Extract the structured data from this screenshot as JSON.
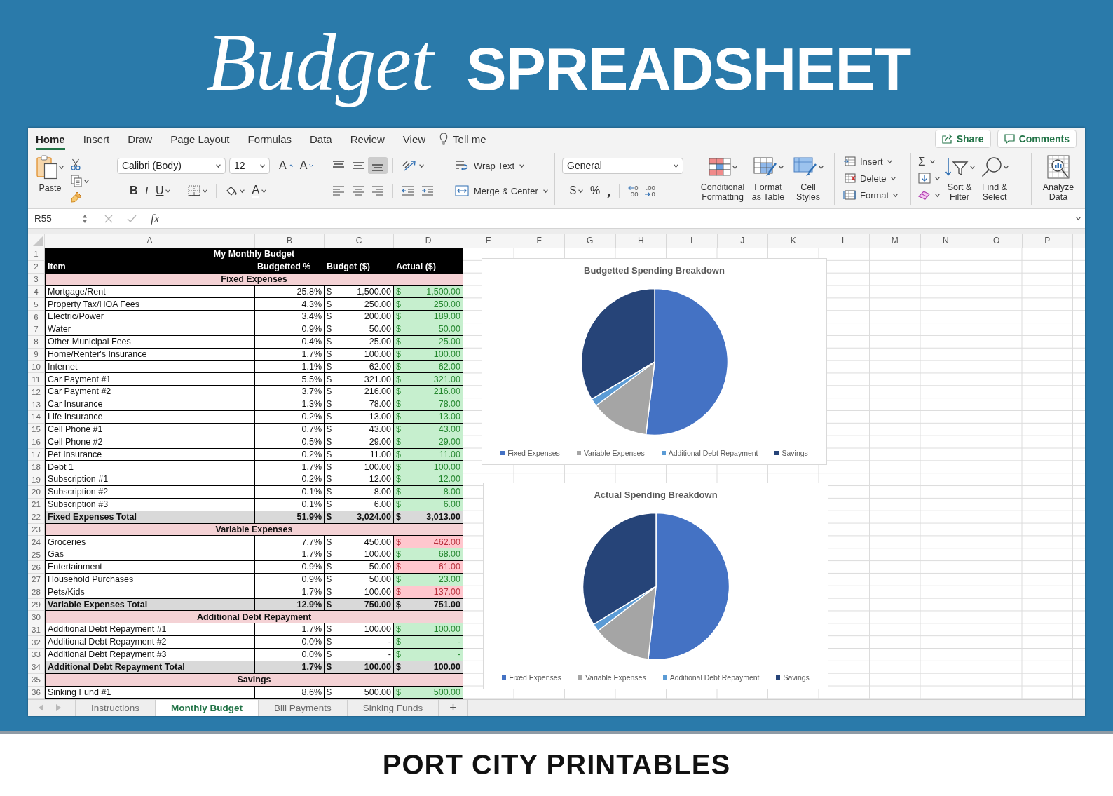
{
  "banner": {
    "script_title": "Budget",
    "title": "SPREADSHEET"
  },
  "menu_tabs": [
    {
      "label": "Home",
      "selected": true
    },
    {
      "label": "Insert",
      "selected": false
    },
    {
      "label": "Draw",
      "selected": false
    },
    {
      "label": "Page Layout",
      "selected": false
    },
    {
      "label": "Formulas",
      "selected": false
    },
    {
      "label": "Data",
      "selected": false
    },
    {
      "label": "Review",
      "selected": false
    },
    {
      "label": "View",
      "selected": false
    }
  ],
  "tell_me": "Tell me",
  "share_button": "Share",
  "comments_button": "Comments",
  "ribbon": {
    "paste": "Paste",
    "font_name": "Calibri (Body)",
    "font_size": "12",
    "grow_font": "A",
    "shrink_font": "A",
    "bold": "B",
    "italic": "I",
    "underline": "U",
    "font_color": "A",
    "vertical_align": [
      {
        "kind": "top",
        "selected": false
      },
      {
        "kind": "middle",
        "selected": false
      },
      {
        "kind": "bottom",
        "selected": true
      }
    ],
    "wrap_text": "Wrap Text",
    "merge_center": "Merge & Center",
    "number_format": "General",
    "currency": "$",
    "percent": "%",
    "comma": ",",
    "decimal_buttons": [
      {
        "kind": "increase",
        "lines": [
          "0",
          ".00"
        ]
      },
      {
        "kind": "decrease",
        "lines": [
          ".00",
          "0"
        ]
      }
    ],
    "style_buttons": [
      {
        "kind": "conditional",
        "label": "Conditional Formatting"
      },
      {
        "kind": "table",
        "label": "Format as Table"
      },
      {
        "kind": "cell_styles",
        "label": "Cell Styles"
      }
    ],
    "cell_buttons": [
      {
        "kind": "insert",
        "label": "Insert"
      },
      {
        "kind": "delete",
        "label": "Delete"
      },
      {
        "kind": "format",
        "label": "Format"
      }
    ],
    "autosum": "Σ",
    "sort_filter": "Sort & Filter",
    "find_select": "Find & Select",
    "analyze_data": "Analyze Data"
  },
  "formula_bar": {
    "cell_reference": "R55",
    "function_label": "fx"
  },
  "columns": [
    "A",
    "B",
    "C",
    "D",
    "E",
    "F",
    "G",
    "H",
    "I",
    "J",
    "K",
    "L",
    "M",
    "N",
    "O",
    "P"
  ],
  "rows": [
    {
      "number": "1",
      "kind": "title",
      "text": "My Monthly Budget"
    },
    {
      "number": "2",
      "kind": "header",
      "cells": [
        "Item",
        "Budgetted %",
        "Budget ($)",
        "Actual ($)"
      ]
    },
    {
      "number": "3",
      "kind": "section",
      "text": "Fixed Expenses"
    },
    {
      "number": "4",
      "kind": "item",
      "item": "Mortgage/Rent",
      "percent": "25.8%",
      "budget": {
        "symbol": "$",
        "amount": "1,500.00"
      },
      "actual": {
        "symbol": "$",
        "amount": "1,500.00"
      },
      "over_budget": false
    },
    {
      "number": "5",
      "kind": "item",
      "item": "Property Tax/HOA Fees",
      "percent": "4.3%",
      "budget": {
        "symbol": "$",
        "amount": "250.00"
      },
      "actual": {
        "symbol": "$",
        "amount": "250.00"
      },
      "over_budget": false
    },
    {
      "number": "6",
      "kind": "item",
      "item": "Electric/Power",
      "percent": "3.4%",
      "budget": {
        "symbol": "$",
        "amount": "200.00"
      },
      "actual": {
        "symbol": "$",
        "amount": "189.00"
      },
      "over_budget": false
    },
    {
      "number": "7",
      "kind": "item",
      "item": "Water",
      "percent": "0.9%",
      "budget": {
        "symbol": "$",
        "amount": "50.00"
      },
      "actual": {
        "symbol": "$",
        "amount": "50.00"
      },
      "over_budget": false
    },
    {
      "number": "8",
      "kind": "item",
      "item": "Other Municipal Fees",
      "percent": "0.4%",
      "budget": {
        "symbol": "$",
        "amount": "25.00"
      },
      "actual": {
        "symbol": "$",
        "amount": "25.00"
      },
      "over_budget": false
    },
    {
      "number": "9",
      "kind": "item",
      "item": "Home/Renter's Insurance",
      "percent": "1.7%",
      "budget": {
        "symbol": "$",
        "amount": "100.00"
      },
      "actual": {
        "symbol": "$",
        "amount": "100.00"
      },
      "over_budget": false
    },
    {
      "number": "10",
      "kind": "item",
      "item": "Internet",
      "percent": "1.1%",
      "budget": {
        "symbol": "$",
        "amount": "62.00"
      },
      "actual": {
        "symbol": "$",
        "amount": "62.00"
      },
      "over_budget": false
    },
    {
      "number": "11",
      "kind": "item",
      "item": "Car Payment #1",
      "percent": "5.5%",
      "budget": {
        "symbol": "$",
        "amount": "321.00"
      },
      "actual": {
        "symbol": "$",
        "amount": "321.00"
      },
      "over_budget": false
    },
    {
      "number": "12",
      "kind": "item",
      "item": "Car Payment #2",
      "percent": "3.7%",
      "budget": {
        "symbol": "$",
        "amount": "216.00"
      },
      "actual": {
        "symbol": "$",
        "amount": "216.00"
      },
      "over_budget": false
    },
    {
      "number": "13",
      "kind": "item",
      "item": "Car Insurance",
      "percent": "1.3%",
      "budget": {
        "symbol": "$",
        "amount": "78.00"
      },
      "actual": {
        "symbol": "$",
        "amount": "78.00"
      },
      "over_budget": false
    },
    {
      "number": "14",
      "kind": "item",
      "item": "Life Insurance",
      "percent": "0.2%",
      "budget": {
        "symbol": "$",
        "amount": "13.00"
      },
      "actual": {
        "symbol": "$",
        "amount": "13.00"
      },
      "over_budget": false
    },
    {
      "number": "15",
      "kind": "item",
      "item": "Cell Phone #1",
      "percent": "0.7%",
      "budget": {
        "symbol": "$",
        "amount": "43.00"
      },
      "actual": {
        "symbol": "$",
        "amount": "43.00"
      },
      "over_budget": false
    },
    {
      "number": "16",
      "kind": "item",
      "item": "Cell Phone #2",
      "percent": "0.5%",
      "budget": {
        "symbol": "$",
        "amount": "29.00"
      },
      "actual": {
        "symbol": "$",
        "amount": "29.00"
      },
      "over_budget": false
    },
    {
      "number": "17",
      "kind": "item",
      "item": "Pet Insurance",
      "percent": "0.2%",
      "budget": {
        "symbol": "$",
        "amount": "11.00"
      },
      "actual": {
        "symbol": "$",
        "amount": "11.00"
      },
      "over_budget": false
    },
    {
      "number": "18",
      "kind": "item",
      "item": "Debt 1",
      "percent": "1.7%",
      "budget": {
        "symbol": "$",
        "amount": "100.00"
      },
      "actual": {
        "symbol": "$",
        "amount": "100.00"
      },
      "over_budget": false
    },
    {
      "number": "19",
      "kind": "item",
      "item": "Subscription #1",
      "percent": "0.2%",
      "budget": {
        "symbol": "$",
        "amount": "12.00"
      },
      "actual": {
        "symbol": "$",
        "amount": "12.00"
      },
      "over_budget": false
    },
    {
      "number": "20",
      "kind": "item",
      "item": "Subscription #2",
      "percent": "0.1%",
      "budget": {
        "symbol": "$",
        "amount": "8.00"
      },
      "actual": {
        "symbol": "$",
        "amount": "8.00"
      },
      "over_budget": false
    },
    {
      "number": "21",
      "kind": "item",
      "item": "Subscription #3",
      "percent": "0.1%",
      "budget": {
        "symbol": "$",
        "amount": "6.00"
      },
      "actual": {
        "symbol": "$",
        "amount": "6.00"
      },
      "over_budget": false
    },
    {
      "number": "22",
      "kind": "total",
      "item": "Fixed Expenses Total",
      "percent": "51.9%",
      "budget": {
        "symbol": "$",
        "amount": "3,024.00"
      },
      "actual": {
        "symbol": "$",
        "amount": "3,013.00"
      }
    },
    {
      "number": "23",
      "kind": "section",
      "text": "Variable Expenses"
    },
    {
      "number": "24",
      "kind": "item",
      "item": "Groceries",
      "percent": "7.7%",
      "budget": {
        "symbol": "$",
        "amount": "450.00"
      },
      "actual": {
        "symbol": "$",
        "amount": "462.00"
      },
      "over_budget": true
    },
    {
      "number": "25",
      "kind": "item",
      "item": "Gas",
      "percent": "1.7%",
      "budget": {
        "symbol": "$",
        "amount": "100.00"
      },
      "actual": {
        "symbol": "$",
        "amount": "68.00"
      },
      "over_budget": false
    },
    {
      "number": "26",
      "kind": "item",
      "item": "Entertainment",
      "percent": "0.9%",
      "budget": {
        "symbol": "$",
        "amount": "50.00"
      },
      "actual": {
        "symbol": "$",
        "amount": "61.00"
      },
      "over_budget": true
    },
    {
      "number": "27",
      "kind": "item",
      "item": "Household Purchases",
      "percent": "0.9%",
      "budget": {
        "symbol": "$",
        "amount": "50.00"
      },
      "actual": {
        "symbol": "$",
        "amount": "23.00"
      },
      "over_budget": false
    },
    {
      "number": "28",
      "kind": "item",
      "item": "Pets/Kids",
      "percent": "1.7%",
      "budget": {
        "symbol": "$",
        "amount": "100.00"
      },
      "actual": {
        "symbol": "$",
        "amount": "137.00"
      },
      "over_budget": true
    },
    {
      "number": "29",
      "kind": "total",
      "item": "Variable Expenses Total",
      "percent": "12.9%",
      "budget": {
        "symbol": "$",
        "amount": "750.00"
      },
      "actual": {
        "symbol": "$",
        "amount": "751.00"
      }
    },
    {
      "number": "30",
      "kind": "section",
      "text": "Additional Debt Repayment"
    },
    {
      "number": "31",
      "kind": "item",
      "item": "Additional Debt Repayment #1",
      "percent": "1.7%",
      "budget": {
        "symbol": "$",
        "amount": "100.00"
      },
      "actual": {
        "symbol": "$",
        "amount": "100.00"
      },
      "over_budget": false
    },
    {
      "number": "32",
      "kind": "item",
      "item": "Additional Debt Repayment #2",
      "percent": "0.0%",
      "budget": {
        "symbol": "$",
        "amount": "-"
      },
      "actual": {
        "symbol": "$",
        "amount": "-"
      },
      "over_budget": false
    },
    {
      "number": "33",
      "kind": "item",
      "item": "Additional Debt Repayment #3",
      "percent": "0.0%",
      "budget": {
        "symbol": "$",
        "amount": "-"
      },
      "actual": {
        "symbol": "$",
        "amount": "-"
      },
      "over_budget": false
    },
    {
      "number": "34",
      "kind": "total",
      "item": "Additional Debt Repayment Total",
      "percent": "1.7%",
      "budget": {
        "symbol": "$",
        "amount": "100.00"
      },
      "actual": {
        "symbol": "$",
        "amount": "100.00"
      }
    },
    {
      "number": "35",
      "kind": "section",
      "text": "Savings"
    },
    {
      "number": "36",
      "kind": "item",
      "item": "Sinking Fund #1",
      "percent": "8.6%",
      "budget": {
        "symbol": "$",
        "amount": "500.00"
      },
      "actual": {
        "symbol": "$",
        "amount": "500.00"
      },
      "over_budget": false
    }
  ],
  "charts": [
    {
      "chart_data": {
        "type": "pie",
        "title": "Budgetted Spending Breakdown",
        "categories": [
          "Fixed Expenses",
          "Variable Expenses",
          "Additional Debt Repayment",
          "Savings"
        ],
        "values": [
          51.9,
          12.9,
          1.7,
          33.5
        ],
        "colors": [
          "#4472c4",
          "#a5a5a5",
          "#5b9bd5",
          "#264478"
        ],
        "legend": "bottom"
      }
    },
    {
      "chart_data": {
        "type": "pie",
        "title": "Actual Spending Breakdown",
        "categories": [
          "Fixed Expenses",
          "Variable Expenses",
          "Additional Debt Repayment",
          "Savings"
        ],
        "values": [
          51.7,
          12.9,
          1.7,
          33.7
        ],
        "colors": [
          "#4472c4",
          "#a5a5a5",
          "#5b9bd5",
          "#264478"
        ],
        "legend": "bottom"
      }
    }
  ],
  "sheet_tabs": [
    {
      "label": "Instructions",
      "selected": false
    },
    {
      "label": "Monthly Budget",
      "selected": true
    },
    {
      "label": "Bill Payments",
      "selected": false
    },
    {
      "label": "Sinking Funds",
      "selected": false
    }
  ],
  "add_sheet": "+",
  "footer": {
    "brand": "PORT CITY PRINTABLES"
  }
}
